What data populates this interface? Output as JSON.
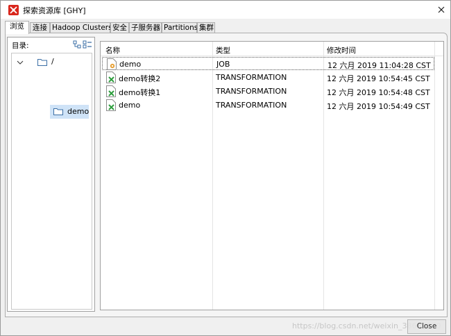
{
  "window": {
    "title": "探索资源库 [GHY]"
  },
  "icons": {
    "app": "app-logo-icon",
    "close": "close-icon",
    "folder": "folder-icon",
    "job": "job-icon",
    "transformation": "transformation-icon",
    "expand": "chevron-down-icon",
    "tree_toggle": "tree-view-toggle-icon"
  },
  "tabs": [
    {
      "label": "浏览"
    },
    {
      "label": "连接"
    },
    {
      "label": "Hadoop Clusters"
    },
    {
      "label": "安全"
    },
    {
      "label": "子服务器"
    },
    {
      "label": "Partitions"
    },
    {
      "label": "集群"
    }
  ],
  "tree": {
    "directory_label": "目录:",
    "root_label": "/",
    "child_label": "demo"
  },
  "list": {
    "headers": {
      "name": "名称",
      "type": "类型",
      "modified": "修改时间"
    },
    "rows": [
      {
        "name": "demo",
        "type": "JOB",
        "modified": "12 六月 2019 11:04:28 CST"
      },
      {
        "name": "demo转换2",
        "type": "TRANSFORMATION",
        "modified": "12 六月 2019 10:54:45 CST"
      },
      {
        "name": "demo转换1",
        "type": "TRANSFORMATION",
        "modified": "12 六月 2019 10:54:48 CST"
      },
      {
        "name": "demo",
        "type": "TRANSFORMATION",
        "modified": "12 六月 2019 10:54:49 CST"
      }
    ]
  },
  "footer": {
    "watermark": "https://blog.csdn.net/weixin_38687670",
    "close_label": "Close"
  },
  "colors": {
    "accent_red": "#d9261c",
    "selection": "#cfe3f7",
    "transformation_green": "#2e9e3e",
    "job_orange": "#e8a33b"
  }
}
